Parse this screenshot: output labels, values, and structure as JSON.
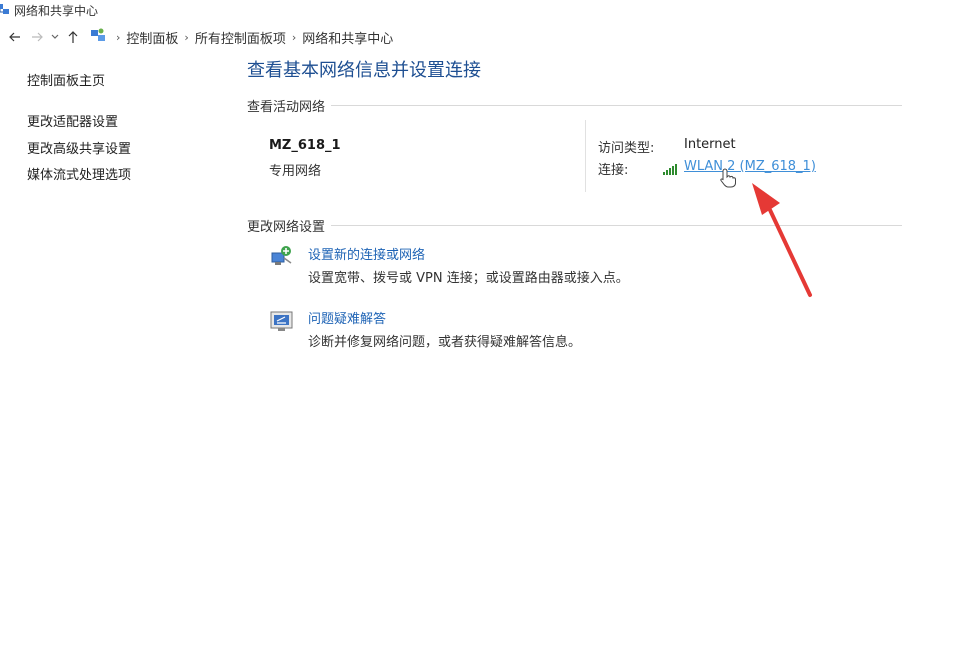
{
  "window": {
    "title": "网络和共享中心"
  },
  "breadcrumb": [
    "控制面板",
    "所有控制面板项",
    "网络和共享中心"
  ],
  "sidebar": {
    "items": [
      "控制面板主页",
      "更改适配器设置",
      "更改高级共享设置",
      "媒体流式处理选项"
    ]
  },
  "main": {
    "title": "查看基本网络信息并设置连接",
    "active_networks": {
      "section_label": "查看活动网络",
      "network_name": "MZ_618_1",
      "network_type": "专用网络",
      "access_type_label": "访问类型:",
      "access_type_value": "Internet",
      "connection_label": "连接:",
      "connection_value": "WLAN 2 (MZ_618_1)"
    },
    "change_settings": {
      "section_label": "更改网络设置",
      "tasks": [
        {
          "title": "设置新的连接或网络",
          "desc": "设置宽带、拨号或 VPN 连接；或设置路由器或接入点。"
        },
        {
          "title": "问题疑难解答",
          "desc": "诊断并修复网络问题，或者获得疑难解答信息。"
        }
      ]
    }
  },
  "colors": {
    "link": "#1e63b5",
    "active_link": "#3f8fd8",
    "title": "#1e4f92",
    "arrow": "#e53935"
  }
}
